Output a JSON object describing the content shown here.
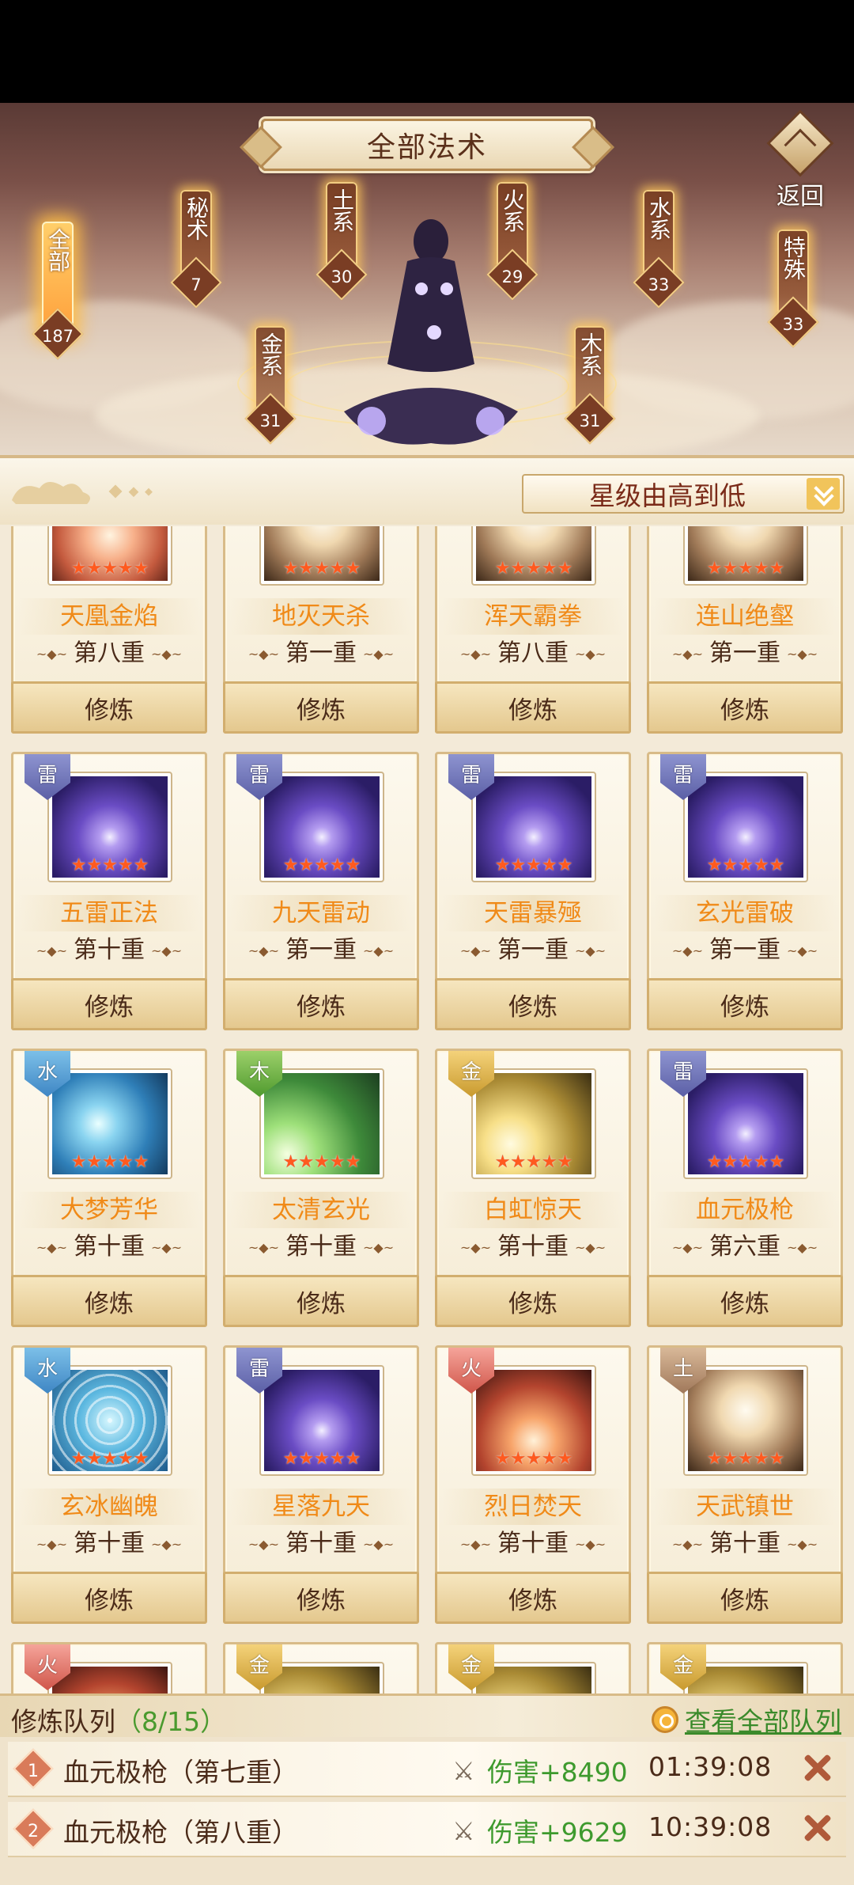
{
  "header": {
    "title": "全部法术",
    "back_label": "返回"
  },
  "categories": [
    {
      "label": "全部",
      "count": "187",
      "active": true
    },
    {
      "label": "秘术",
      "count": "7"
    },
    {
      "label": "土系",
      "count": "30"
    },
    {
      "label": "金系",
      "count": "31"
    },
    {
      "label": "火系",
      "count": "29"
    },
    {
      "label": "木系",
      "count": "31"
    },
    {
      "label": "水系",
      "count": "33"
    },
    {
      "label": "特殊",
      "count": "33"
    }
  ],
  "sort": {
    "label": "星级由高到低"
  },
  "stars": "★★★★★",
  "train_label": "修炼",
  "spells": [
    {
      "name": "天凰金焰",
      "level": "第八重",
      "badge": "",
      "art": "art-fire2"
    },
    {
      "name": "地灭天杀",
      "level": "第一重",
      "badge": "",
      "art": "art-tu"
    },
    {
      "name": "浑天霸拳",
      "level": "第八重",
      "badge": "",
      "art": "art-tu"
    },
    {
      "name": "连山绝壑",
      "level": "第一重",
      "badge": "",
      "art": "art-tu"
    },
    {
      "name": "五雷正法",
      "level": "第十重",
      "badge": "雷",
      "badge_class": "b-lei",
      "art": "art-lei"
    },
    {
      "name": "九天雷动",
      "level": "第一重",
      "badge": "雷",
      "badge_class": "b-lei",
      "art": "art-lei"
    },
    {
      "name": "天雷暴殛",
      "level": "第一重",
      "badge": "雷",
      "badge_class": "b-lei",
      "art": "art-lei"
    },
    {
      "name": "玄光雷破",
      "level": "第一重",
      "badge": "雷",
      "badge_class": "b-lei",
      "art": "art-lei"
    },
    {
      "name": "大梦芳华",
      "level": "第十重",
      "badge": "水",
      "badge_class": "b-shui",
      "art": "art-shui"
    },
    {
      "name": "太清玄光",
      "level": "第十重",
      "badge": "木",
      "badge_class": "b-mu",
      "art": "art-mu"
    },
    {
      "name": "白虹惊天",
      "level": "第十重",
      "badge": "金",
      "badge_class": "b-jin",
      "art": "art-jin"
    },
    {
      "name": "血元极枪",
      "level": "第六重",
      "badge": "雷",
      "badge_class": "b-lei",
      "art": "art-lei"
    },
    {
      "name": "玄冰幽魄",
      "level": "第十重",
      "badge": "水",
      "badge_class": "b-shui",
      "art": "art-wave"
    },
    {
      "name": "星落九天",
      "level": "第十重",
      "badge": "雷",
      "badge_class": "b-lei",
      "art": "art-lei"
    },
    {
      "name": "烈日焚天",
      "level": "第十重",
      "badge": "火",
      "badge_class": "b-huo",
      "art": "art-huo"
    },
    {
      "name": "天武镇世",
      "level": "第十重",
      "badge": "土",
      "badge_class": "b-tu",
      "art": "art-tu"
    },
    {
      "name": "",
      "level": "",
      "badge": "火",
      "badge_class": "b-huo",
      "art": "art-huo"
    },
    {
      "name": "",
      "level": "",
      "badge": "金",
      "badge_class": "b-jin",
      "art": "art-jin"
    },
    {
      "name": "",
      "level": "",
      "badge": "金",
      "badge_class": "b-jin",
      "art": "art-jin"
    },
    {
      "name": "",
      "level": "",
      "badge": "金",
      "badge_class": "b-jin",
      "art": "art-jin"
    }
  ],
  "queue": {
    "title": "修炼队列",
    "count": "（8/15）",
    "view_all": "查看全部队列",
    "items": [
      {
        "num": "1",
        "name": "血元极枪（第七重）",
        "damage": "伤害+8490",
        "time": "01:39:08"
      },
      {
        "num": "2",
        "name": "血元极枪（第八重）",
        "damage": "伤害+9629",
        "time": "10:39:08"
      }
    ]
  }
}
